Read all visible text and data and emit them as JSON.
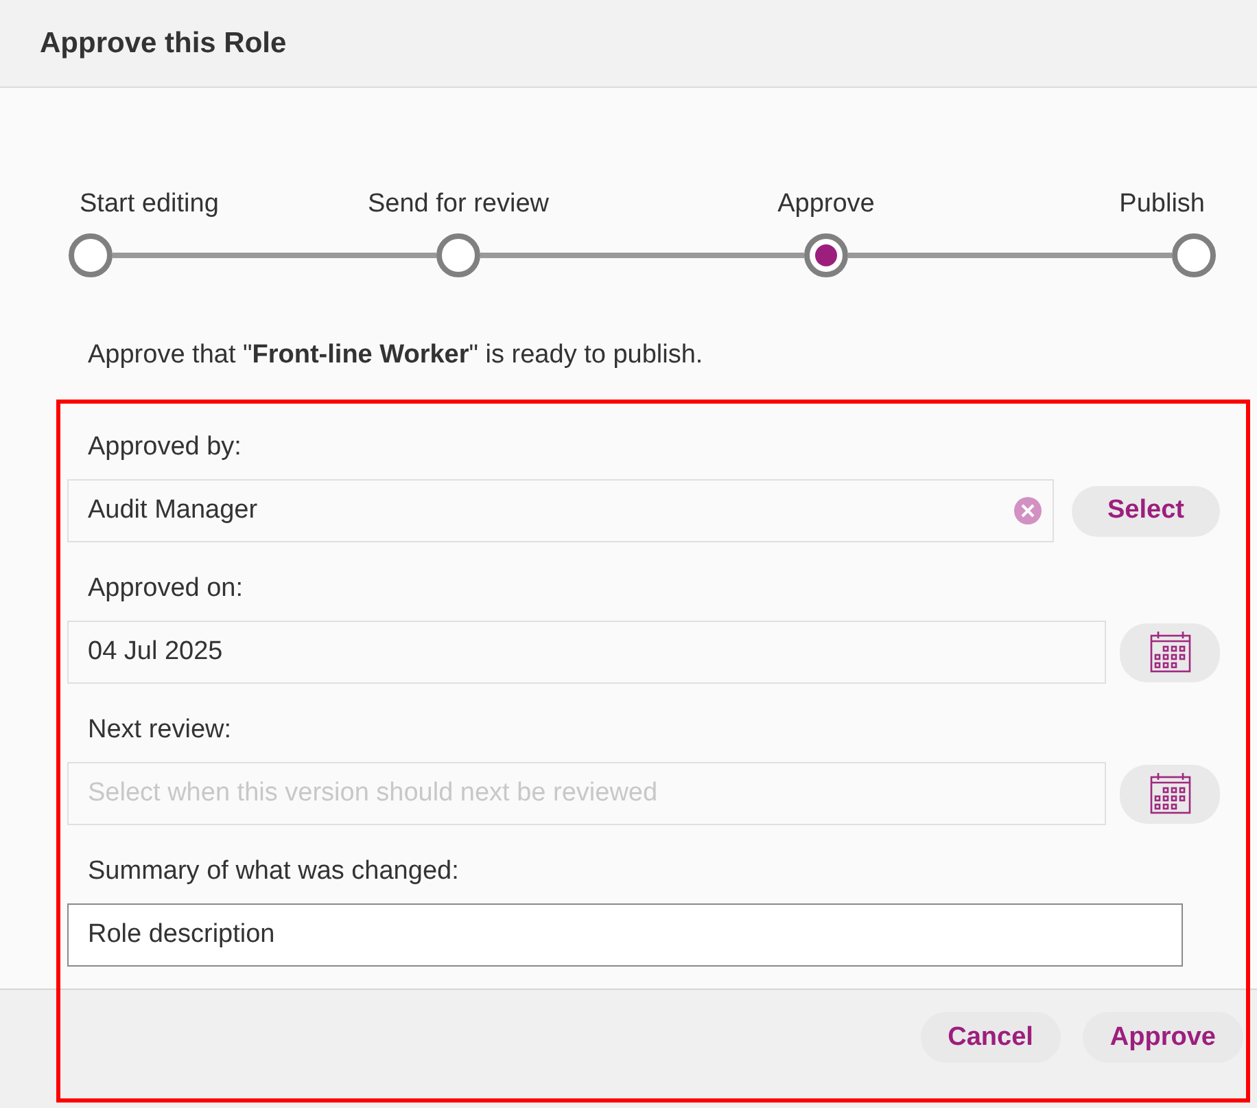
{
  "window": {
    "title": "Approve this Role"
  },
  "steps": [
    {
      "label": "Start editing",
      "selected": false
    },
    {
      "label": "Send for review",
      "selected": false
    },
    {
      "label": "Approve",
      "selected": true
    },
    {
      "label": "Publish",
      "selected": false
    }
  ],
  "description": "Approve that \"**Front-line Worker**\" is ready to publish.",
  "fields": [
    {
      "kind": "picker",
      "label": "Approved by:",
      "value": "Audit Manager",
      "action": "Select"
    },
    {
      "kind": "date",
      "label": "Approved on:",
      "value": "04 Jul 2025"
    },
    {
      "kind": "date",
      "label": "Next review:",
      "placeholder": "Select when this version should next be reviewed"
    },
    {
      "kind": "text",
      "label": "Summary of what was changed:",
      "value": "Role description"
    }
  ],
  "buttons": [
    "Cancel",
    "Approve"
  ]
}
